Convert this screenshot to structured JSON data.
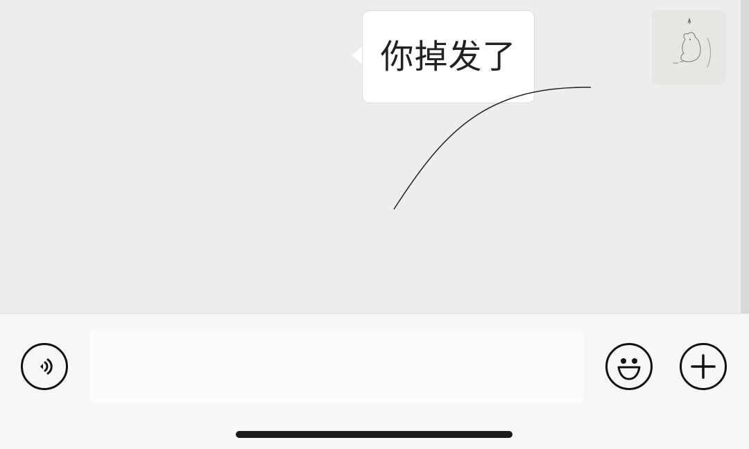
{
  "chat": {
    "messages": [
      {
        "text": "你掉发了",
        "side": "right"
      }
    ],
    "avatar_icon": "sketch-avatar-icon"
  },
  "input_bar": {
    "voice_icon": "voice-icon",
    "message_value": "",
    "message_placeholder": "",
    "emoji_icon": "emoji-icon",
    "plus_icon": "plus-icon"
  },
  "colors": {
    "chat_background": "#ededed",
    "bubble_background": "#ffffff",
    "input_bar_background": "#f7f7f7",
    "icon_stroke": "#111111"
  }
}
